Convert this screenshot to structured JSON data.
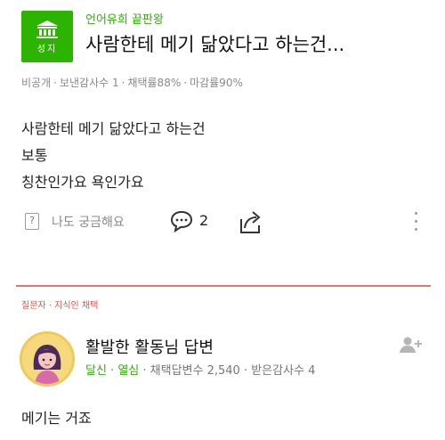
{
  "question": {
    "badge_label": "성지",
    "level": "언어유희 끝판왕",
    "title": "사람한테 메기 닮았다고 하는건...",
    "meta": {
      "visibility": "비공개",
      "thanks": "보낸감사수 1",
      "adoption_rate": "채택률88%",
      "deadline_rate": "마감률90%"
    },
    "body_lines": [
      "사람한테 메기 닮았다고 하는건",
      "보통",
      "칭찬인가요 욕인가요"
    ],
    "actions": {
      "curious_box": "?",
      "curious_label": "나도 궁금해요",
      "comment_count": "2"
    }
  },
  "answer": {
    "tag": "질문자 · 지식인 채택",
    "answerer_name": "활발한 활동님 답변",
    "meta": {
      "rank1": "달신",
      "rank2": "열심",
      "adopted": "채택답변수 2,540",
      "thanks": "받은감사수 4"
    },
    "body": "메기는 거죠"
  },
  "colors": {
    "brand_green": "#2db400",
    "accent_red": "#e0574b",
    "divider": "#e8756b"
  },
  "icons": [
    "temple-icon",
    "question-box-icon",
    "comment-icon",
    "share-icon",
    "more-icon",
    "avatar",
    "follow-icon"
  ]
}
